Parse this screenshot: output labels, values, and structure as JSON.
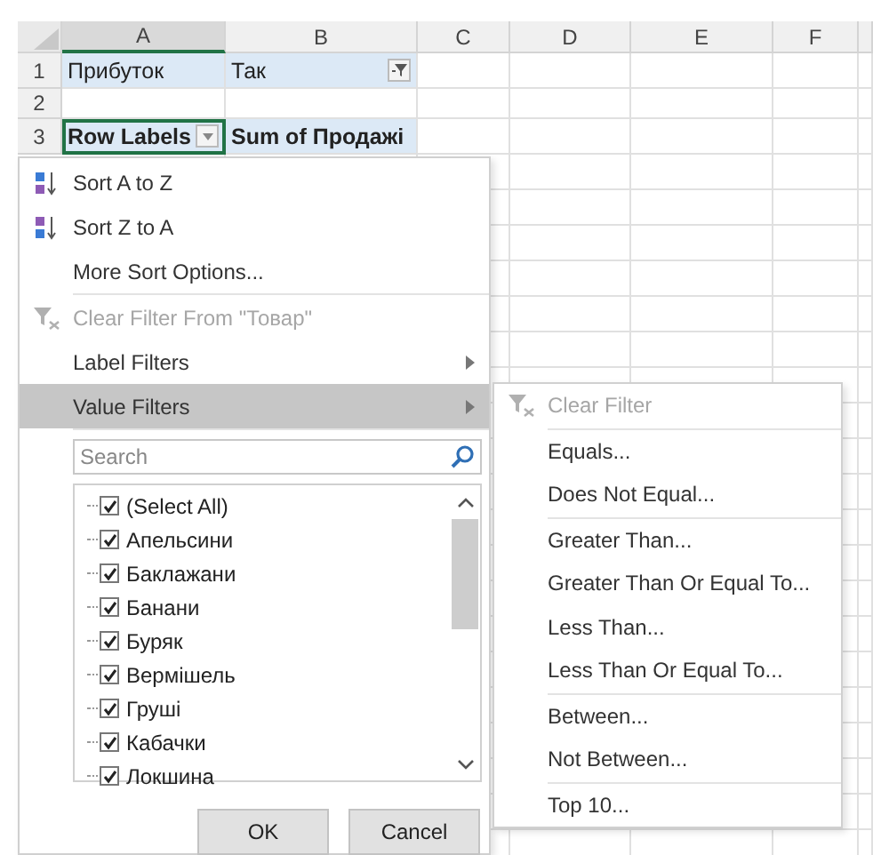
{
  "columns": [
    "A",
    "B",
    "C",
    "D",
    "E",
    "F"
  ],
  "rows": [
    {
      "number": "1",
      "shaded": true,
      "cells": [
        {
          "text": "Прибуток",
          "bold": false,
          "kind": "plain",
          "selected": false
        },
        {
          "text": "Так",
          "bold": false,
          "kind": "filter",
          "selected": false
        }
      ]
    },
    {
      "number": "2",
      "shaded": false,
      "cells": []
    },
    {
      "number": "3",
      "shaded": true,
      "cells": [
        {
          "text": "Row Labels",
          "bold": true,
          "kind": "dropdown",
          "selected": true
        },
        {
          "text": "Sum of Продажі",
          "bold": true,
          "kind": "plain",
          "selected": false
        }
      ]
    }
  ],
  "filter_menu": {
    "items": [
      {
        "label": "Sort A to Z",
        "kind": "ascending",
        "disabled": false,
        "submenu": false,
        "selected": false,
        "separator_after": false
      },
      {
        "label": "Sort Z to A",
        "kind": "descending",
        "disabled": false,
        "submenu": false,
        "selected": false,
        "separator_after": false
      },
      {
        "label": "More Sort Options...",
        "kind": "plain",
        "disabled": false,
        "submenu": false,
        "selected": false,
        "separator_after": true
      },
      {
        "label": "Clear Filter From \"Товар\"",
        "kind": "clear",
        "disabled": true,
        "submenu": false,
        "selected": false,
        "separator_after": false
      },
      {
        "label": "Label Filters",
        "kind": "plain",
        "disabled": false,
        "submenu": true,
        "selected": false,
        "separator_after": false
      },
      {
        "label": "Value Filters",
        "kind": "plain",
        "disabled": false,
        "submenu": true,
        "selected": true,
        "separator_after": true
      }
    ],
    "search": {
      "placeholder": "Search"
    },
    "checklist": [
      {
        "label": "(Select All)",
        "checked": true
      },
      {
        "label": "Апельсини",
        "checked": true
      },
      {
        "label": "Баклажани",
        "checked": true
      },
      {
        "label": "Банани",
        "checked": true
      },
      {
        "label": "Буряк",
        "checked": true
      },
      {
        "label": "Вермішель",
        "checked": true
      },
      {
        "label": "Груші",
        "checked": true
      },
      {
        "label": "Кабачки",
        "checked": true
      },
      {
        "label": "Локшина",
        "checked": true
      }
    ],
    "buttons": [
      "OK",
      "Cancel"
    ]
  },
  "value_filters_menu": {
    "items": [
      {
        "label": "Clear Filter",
        "kind": "clear",
        "disabled": true,
        "separator_after": true
      },
      {
        "label": "Equals...",
        "kind": "plain",
        "disabled": false,
        "separator_after": false
      },
      {
        "label": "Does Not Equal...",
        "kind": "plain",
        "disabled": false,
        "separator_after": true
      },
      {
        "label": "Greater Than...",
        "kind": "plain",
        "disabled": false,
        "separator_after": false
      },
      {
        "label": "Greater Than Or Equal To...",
        "kind": "plain",
        "disabled": false,
        "separator_after": false
      },
      {
        "label": "Less Than...",
        "kind": "plain",
        "disabled": false,
        "separator_after": false
      },
      {
        "label": "Less Than Or Equal To...",
        "kind": "plain",
        "disabled": false,
        "separator_after": true
      },
      {
        "label": "Between...",
        "kind": "plain",
        "disabled": false,
        "separator_after": false
      },
      {
        "label": "Not Between...",
        "kind": "plain",
        "disabled": false,
        "separator_after": true
      },
      {
        "label": "Top 10...",
        "kind": "plain",
        "disabled": false,
        "separator_after": false
      }
    ]
  }
}
